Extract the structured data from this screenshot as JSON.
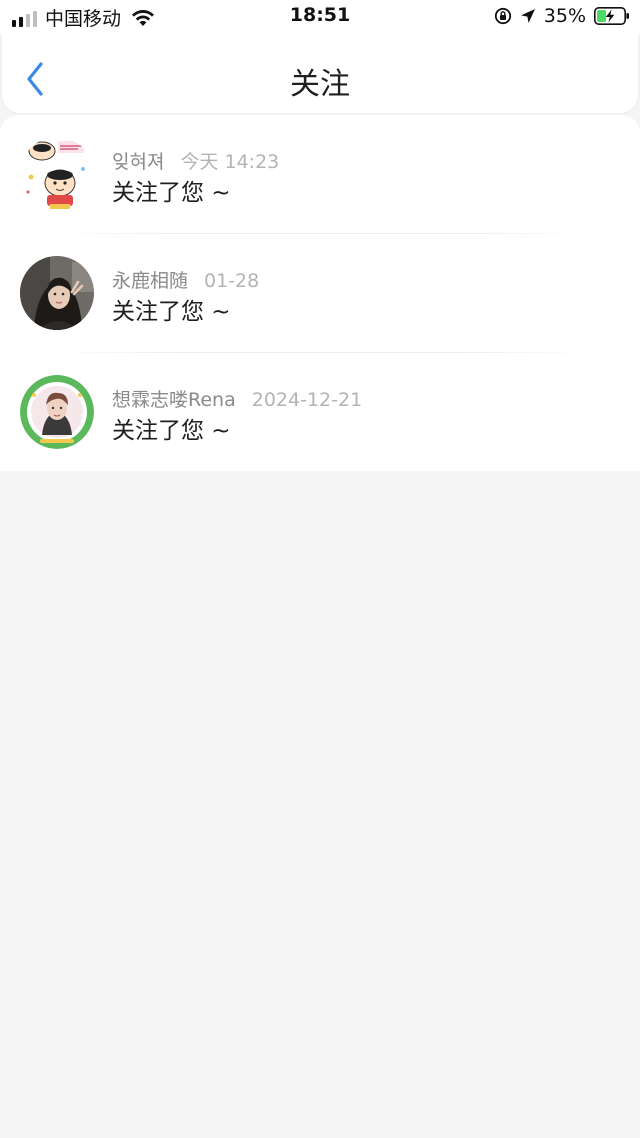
{
  "status_bar": {
    "carrier": "中国移动",
    "time": "18:51",
    "battery_pct": "35%",
    "battery_level": 0.35,
    "signal_bars": 2
  },
  "header": {
    "title": "关注",
    "back_icon": "chevron-left-icon",
    "accent": "#3d8ae6"
  },
  "follows": [
    {
      "username": "잊혀져",
      "time": "今天 14:23",
      "message": "关注了您 ~"
    },
    {
      "username": "永鹿相随",
      "time": "01-28",
      "message": "关注了您 ~"
    },
    {
      "username": "想霖志喽Rena",
      "time": "2024-12-21",
      "message": "关注了您 ~"
    }
  ]
}
